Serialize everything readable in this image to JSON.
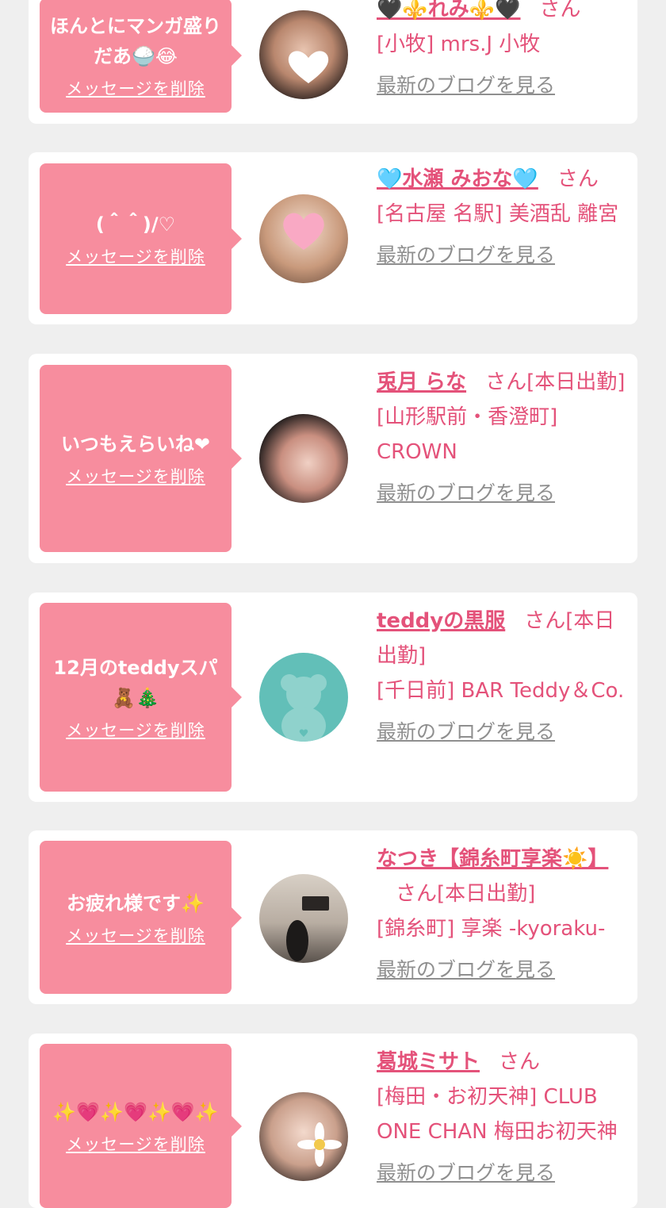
{
  "cards": [
    {
      "message": "ほんとにマンガ盛りだあ🍚😂",
      "delete_label": "メッセージを削除",
      "name": "🖤⚜️れみ⚜️🖤",
      "honorific": "さん",
      "shop": "[小牧] mrs.J 小牧",
      "blog_link": "最新のブログを見る",
      "avatar_desc": "woman-heart-sticker"
    },
    {
      "message": "(＾＾)/♡",
      "delete_label": "メッセージを削除",
      "name": "🩵水瀬 みおな🩵",
      "honorific": "さん",
      "shop": "[名古屋 名駅] 美酒乱 離宮",
      "blog_link": "最新のブログを見る",
      "avatar_desc": "woman-heart-sticker"
    },
    {
      "message": "いつもえらいね❤",
      "delete_label": "メッセージを削除",
      "name": "兎月 らな",
      "honorific": "さん[本日出勤]",
      "shop": "[山形駅前・香澄町] CROWN",
      "blog_link": "最新のブログを見る",
      "avatar_desc": "woman-photo"
    },
    {
      "message": "12月のteddyスパ🧸🎄",
      "delete_label": "メッセージを削除",
      "name": "teddyの黒服",
      "honorific": "さん[本日出勤]",
      "shop": "[千日前] BAR Teddy＆Co.",
      "blog_link": "最新のブログを見る",
      "avatar_desc": "teddy-bear-placeholder"
    },
    {
      "message": "お疲れ様です✨",
      "delete_label": "メッセージを削除",
      "name": "なつき【錦糸町享楽☀️】",
      "honorific": "さん[本日出勤]",
      "shop": "[錦糸町] 享楽 -kyoraku-",
      "blog_link": "最新のブログを見る",
      "avatar_desc": "room-photo"
    },
    {
      "message": "✨💗✨💗✨💗✨",
      "delete_label": "メッセージを削除",
      "name": "葛城ミサト",
      "honorific": "さん",
      "shop": "[梅田・お初天神] CLUB ONE CHAN 梅田お初天神",
      "blog_link": "最新のブログを見る",
      "avatar_desc": "woman-flower-sticker"
    }
  ]
}
